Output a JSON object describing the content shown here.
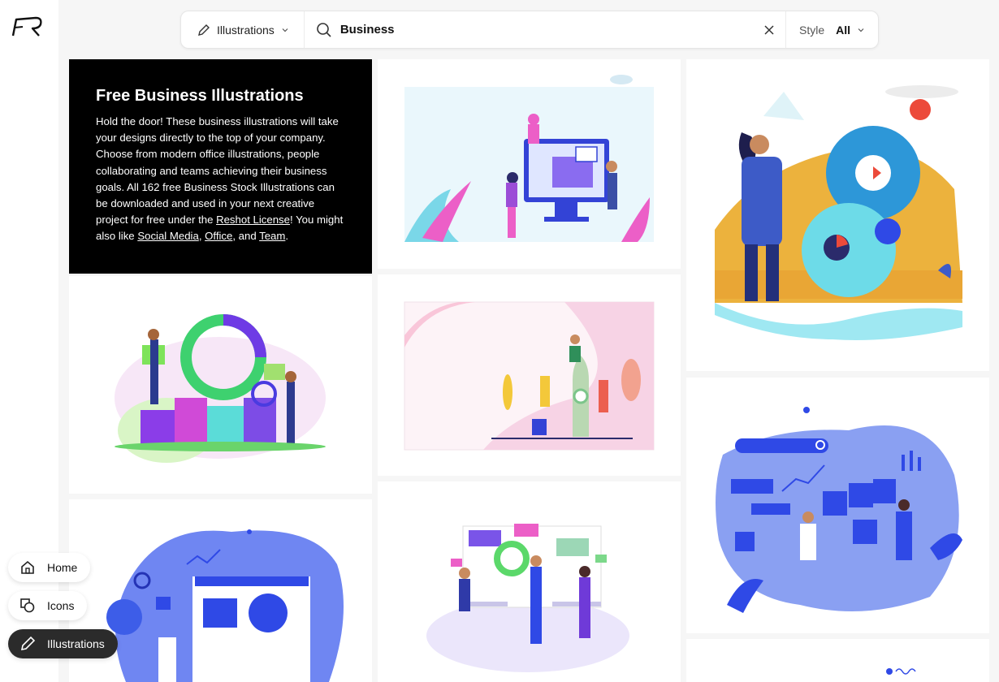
{
  "search": {
    "type_label": "Illustrations",
    "query": "Business",
    "style_label": "Style",
    "style_value": "All"
  },
  "promo": {
    "title": "Free Business Illustrations",
    "body_1": "Hold the door! These business illustrations will take your designs directly to the top of your company. Choose from modern office illustrations, people collaborating and teams achieving their business goals. All 162 free Business Stock Illustrations can be downloaded and used in your next creative project for free under the ",
    "license_link": "Reshot License",
    "body_2": "! You might also like ",
    "link_social": "Social Media",
    "sep_1": ", ",
    "link_office": "Office",
    "sep_2": ", and ",
    "link_team": "Team",
    "end": "."
  },
  "nav": {
    "home": "Home",
    "icons": "Icons",
    "illustrations": "Illustrations"
  },
  "colors": {
    "accent": "#2f49e6",
    "dark": "#2b2b2b",
    "pink": "#ec5fc7",
    "orange": "#f0b03c"
  }
}
